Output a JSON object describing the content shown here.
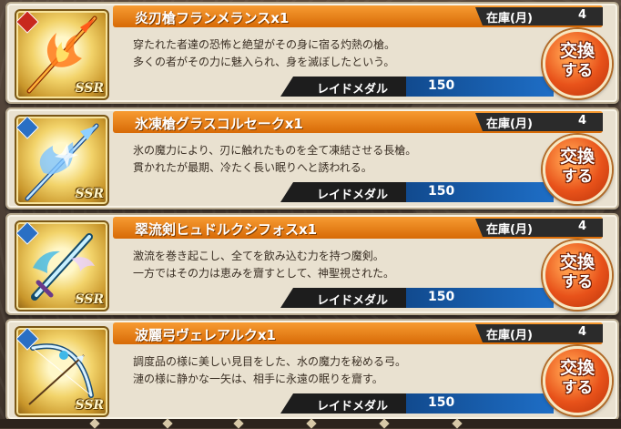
{
  "items": [
    {
      "name": "炎刃槍フランメランスx1",
      "stock_label": "在庫(月)",
      "stock_value": "4",
      "desc_line1": "穿たれた者達の恐怖と絶望がその身に宿る灼熱の槍。",
      "desc_line2": "多くの者がその力に魅入られ、身を滅ぼしたという。",
      "currency_label": "レイドメダル",
      "price": "150",
      "rarity": "SSR",
      "element": "fire",
      "element_color": "#c8281e",
      "weapon_icon": "flame-spear-icon",
      "exchange_line1": "交換",
      "exchange_line2": "する"
    },
    {
      "name": "氷凍槍グラスコルセークx1",
      "stock_label": "在庫(月)",
      "stock_value": "4",
      "desc_line1": "氷の魔力により、刃に触れたものを全て凍結させる長槍。",
      "desc_line2": "貫かれたが最期、冷たく長い眠りへと誘われる。",
      "currency_label": "レイドメダル",
      "price": "150",
      "rarity": "SSR",
      "element": "water",
      "element_color": "#2a6fc4",
      "weapon_icon": "ice-spear-icon",
      "exchange_line1": "交換",
      "exchange_line2": "する"
    },
    {
      "name": "翠流剣ヒュドルクシフォスx1",
      "stock_label": "在庫(月)",
      "stock_value": "4",
      "desc_line1": "激流を巻き起こし、全てを飲み込む力を持つ魔剣。",
      "desc_line2": "一方ではその力は恵みを齎すとして、神聖視された。",
      "currency_label": "レイドメダル",
      "price": "150",
      "rarity": "SSR",
      "element": "water",
      "element_color": "#2a6fc4",
      "weapon_icon": "water-sword-icon",
      "exchange_line1": "交換",
      "exchange_line2": "する"
    },
    {
      "name": "波麗弓ヴェレアルクx1",
      "stock_label": "在庫(月)",
      "stock_value": "4",
      "desc_line1": "調度品の様に美しい見目をした、水の魔力を秘める弓。",
      "desc_line2": "漣の様に静かな一矢は、相手に永遠の眠りを齎す。",
      "currency_label": "レイドメダル",
      "price": "150",
      "rarity": "SSR",
      "element": "water",
      "element_color": "#2a6fc4",
      "weapon_icon": "water-bow-icon",
      "exchange_line1": "交換",
      "exchange_line2": "する"
    }
  ]
}
